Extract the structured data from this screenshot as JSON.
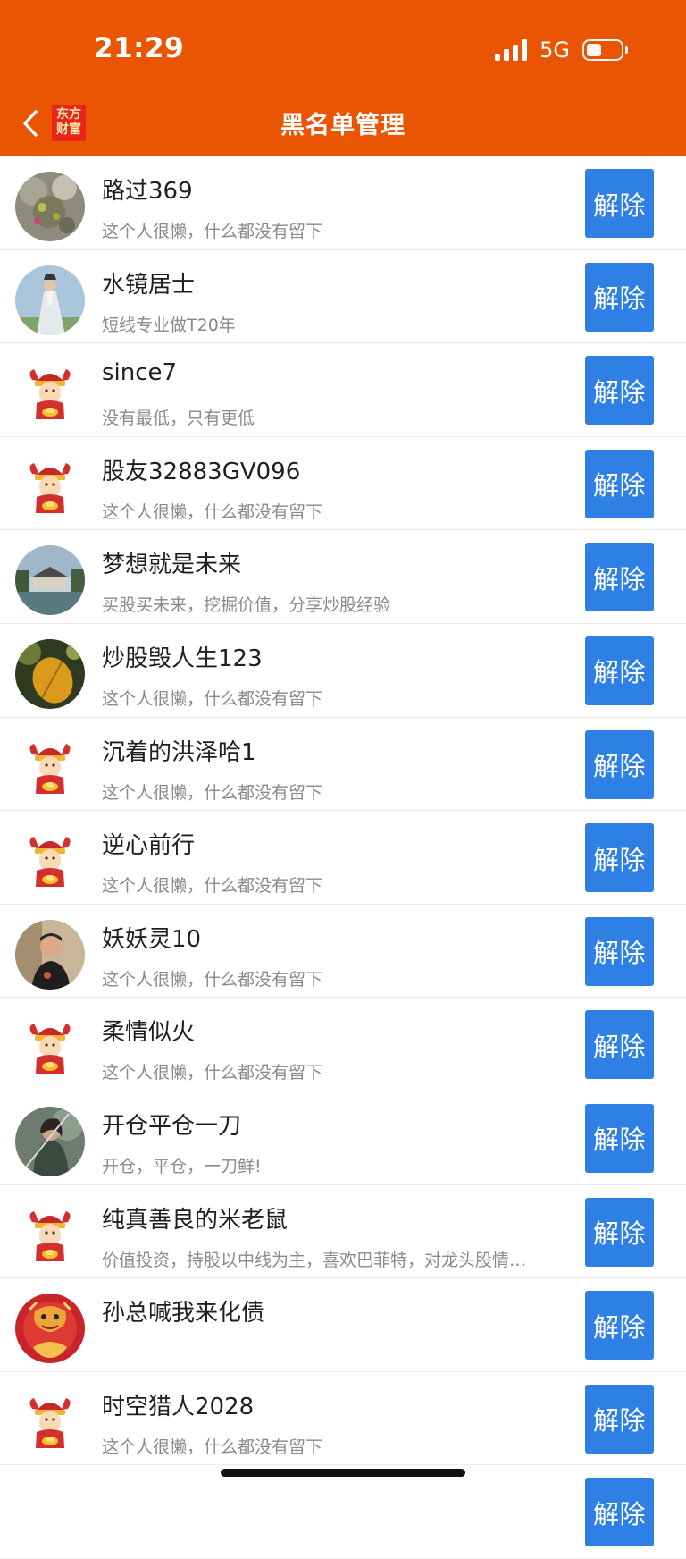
{
  "status": {
    "time": "21:29",
    "network": "5G",
    "battery_level": 0.45
  },
  "nav": {
    "title": "黑名单管理",
    "logo_text": "东方财富"
  },
  "accent": "#EA5504",
  "button_color": "#2F80E4",
  "unblock_label": "解除",
  "rows": [
    {
      "name": "路过369",
      "bio": "这个人很懒，什么都没有留下",
      "avatar": "photo-plant"
    },
    {
      "name": "水镜居士",
      "bio": "短线专业做T20年",
      "avatar": "photo-sage"
    },
    {
      "name": "since7",
      "bio": "没有最低，只有更低",
      "avatar": "god-of-wealth"
    },
    {
      "name": "股友32883GV096",
      "bio": "这个人很懒，什么都没有留下",
      "avatar": "god-of-wealth"
    },
    {
      "name": "梦想就是未来",
      "bio": "买股买未来，挖掘价值，分享炒股经验",
      "avatar": "photo-pavilion"
    },
    {
      "name": "炒股毁人生123",
      "bio": "这个人很懒，什么都没有留下",
      "avatar": "photo-leaf"
    },
    {
      "name": "沉着的洪泽哈1",
      "bio": "这个人很懒，什么都没有留下",
      "avatar": "god-of-wealth"
    },
    {
      "name": "逆心前行",
      "bio": "这个人很懒，什么都没有留下",
      "avatar": "god-of-wealth"
    },
    {
      "name": "妖妖灵10",
      "bio": "这个人很懒，什么都没有留下",
      "avatar": "photo-person"
    },
    {
      "name": "柔情似火",
      "bio": "这个人很懒，什么都没有留下",
      "avatar": "god-of-wealth"
    },
    {
      "name": "开仓平仓一刀",
      "bio": "开仓，平仓，一刀鲜!",
      "avatar": "photo-warrior"
    },
    {
      "name": "纯真善良的米老鼠",
      "bio": "价值投资，持股以中线为主，喜欢巴菲特，对龙头股情…",
      "avatar": "god-of-wealth"
    },
    {
      "name": "孙总喊我来化债",
      "bio": "",
      "avatar": "photo-dragon"
    },
    {
      "name": "时空猎人2028",
      "bio": "这个人很懒，什么都没有留下",
      "avatar": "god-of-wealth"
    },
    {
      "name": "",
      "bio": "",
      "avatar": ""
    }
  ]
}
